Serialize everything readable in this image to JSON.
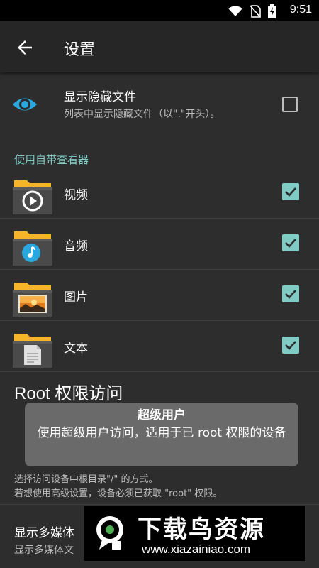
{
  "status_bar": {
    "time": "9:51"
  },
  "app_bar": {
    "title": "设置"
  },
  "show_hidden": {
    "title": "显示隐藏文件",
    "subtitle": "列表中显示隐藏文件（以\".\"开头）。",
    "checked": false
  },
  "viewer_section": {
    "label": "使用自带查看器",
    "items": [
      {
        "label": "视频",
        "icon": "video-play-icon",
        "checked": true
      },
      {
        "label": "音频",
        "icon": "music-note-icon",
        "checked": true
      },
      {
        "label": "图片",
        "icon": "picture-icon",
        "checked": true
      },
      {
        "label": "文本",
        "icon": "document-icon",
        "checked": true
      }
    ]
  },
  "root_section": {
    "title": "Root 权限访问",
    "desc_line1": "选择访问设备中根目录\"/\" 的方式。",
    "desc_line2": "若想使用高级设置，设备必须已获取 \"root\" 权限。"
  },
  "toast": {
    "title": "超级用户",
    "message": "使用超级用户访问，适用于已 root 权限的设备"
  },
  "media_section": {
    "title": "显示多媒体",
    "subtitle": "显示多媒体文"
  },
  "watermark": {
    "title": "下载鸟资源",
    "url": "www.xiazainiao.com"
  },
  "colors": {
    "accent": "#80cbc4",
    "background": "#2d2d2d",
    "app_bar": "#262626",
    "eye_icon": "#29a8e0",
    "folder": "#f5b528"
  }
}
